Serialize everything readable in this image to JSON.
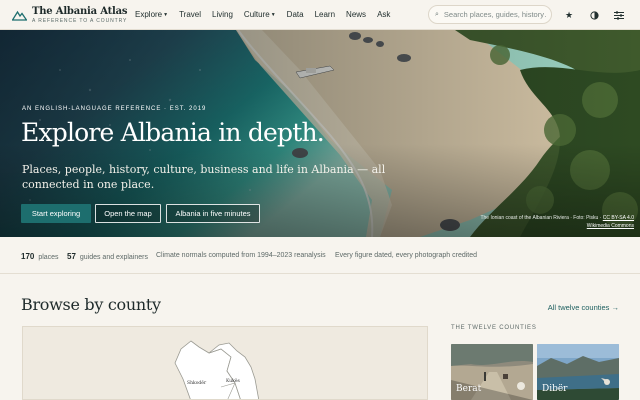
{
  "header": {
    "logo_name": "The Albania Atlas",
    "logo_tagline": "A REFERENCE TO A COUNTRY",
    "nav": [
      {
        "label": "Explore",
        "dropdown": true
      },
      {
        "label": "Travel",
        "dropdown": false
      },
      {
        "label": "Living",
        "dropdown": false
      },
      {
        "label": "Culture",
        "dropdown": true
      },
      {
        "label": "Data",
        "dropdown": false
      },
      {
        "label": "Learn",
        "dropdown": false
      },
      {
        "label": "News",
        "dropdown": false
      },
      {
        "label": "Ask",
        "dropdown": false
      }
    ],
    "search_placeholder": "Search places, guides, history…",
    "icons": [
      "star-icon",
      "contrast-icon",
      "sliders-icon"
    ]
  },
  "hero": {
    "kicker": "AN ENGLISH-LANGUAGE REFERENCE · EST. 2019",
    "title": "Explore Albania in depth.",
    "subtitle": "Places, people, history, culture, business and life in Albania — all connected in one place.",
    "buttons": {
      "primary": "Start exploring",
      "map": "Open the map",
      "five": "Albania in five minutes"
    },
    "credit_line1": "The Ionian coast of the Albanian Riviera · Foto: Pisku · ",
    "credit_license": "CC BY-SA 4.0",
    "credit_line2": "Wikimedia Commons"
  },
  "stats": {
    "places_value": "170",
    "places_label": "places",
    "guides_value": "57",
    "guides_label": "guides and explainers",
    "climate_note": "Climate normals computed from 1994–2023 reanalysis",
    "dated_note": "Every figure dated, every photograph credited"
  },
  "browse": {
    "title": "Browse by county",
    "all_link": "All twelve counties →",
    "map_labels": [
      "Shkodër",
      "Kukës"
    ],
    "twelve_label": "THE TWELVE COUNTIES",
    "counties": [
      "Berat",
      "Dibër"
    ]
  },
  "colors": {
    "accent": "#1d6e6e",
    "background": "#f7f4ee"
  }
}
